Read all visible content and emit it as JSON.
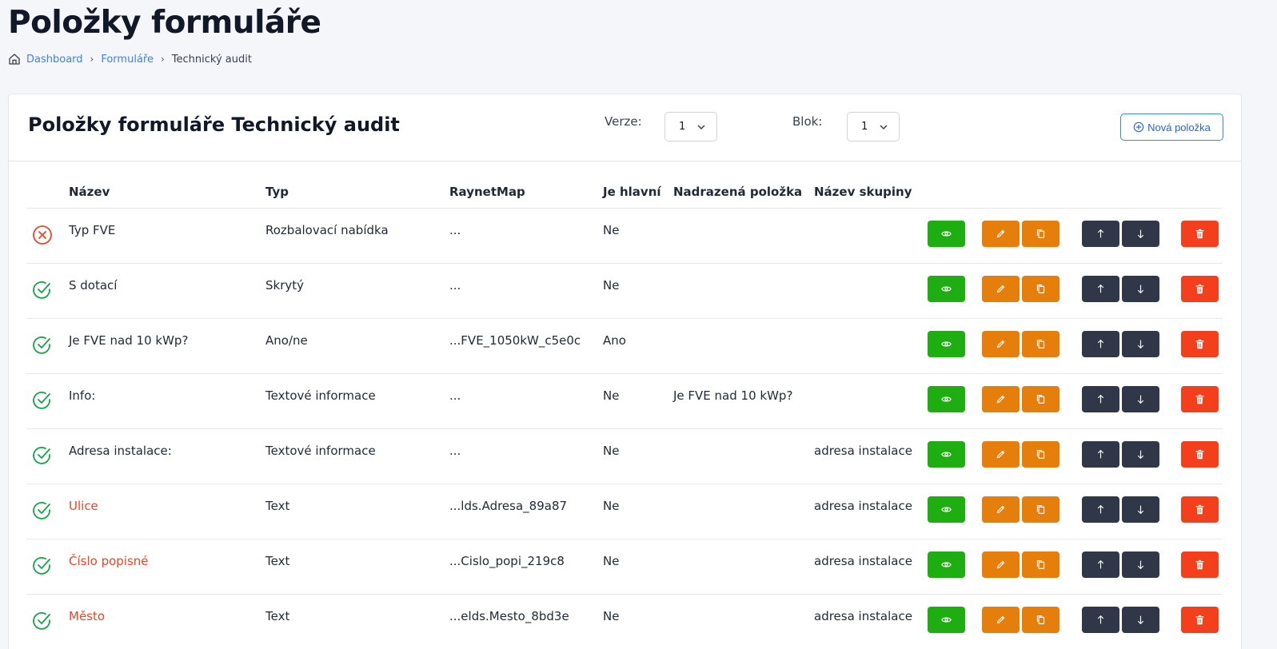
{
  "page": {
    "title": "Položky formuláře",
    "breadcrumb": [
      "Dashboard",
      "Formuláře",
      "Technický audit"
    ]
  },
  "card": {
    "title": "Položky formuláře Technický audit",
    "version_label": "Verze:",
    "version_value": "1",
    "block_label": "Blok:",
    "block_value": "1",
    "new_item_label": "Nová položka"
  },
  "table": {
    "columns": [
      "Název",
      "Typ",
      "RaynetMap",
      "Je hlavní",
      "Nadrazená položka",
      "Název skupiny"
    ],
    "rows": [
      {
        "status": "invalid",
        "name": "Typ FVE",
        "required": false,
        "type": "Rozbalovací nabídka",
        "raynet": "...",
        "main": "Ne",
        "parent": "",
        "group": ""
      },
      {
        "status": "valid",
        "name": "S dotací",
        "required": false,
        "type": "Skrytý",
        "raynet": "...",
        "main": "Ne",
        "parent": "",
        "group": ""
      },
      {
        "status": "valid",
        "name": "Je FVE nad 10 kWp?",
        "required": false,
        "type": "Ano/ne",
        "raynet": "...FVE_1050kW_c5e0c",
        "main": "Ano",
        "parent": "",
        "group": ""
      },
      {
        "status": "valid",
        "name": "Info:",
        "required": false,
        "type": "Textové informace",
        "raynet": "...",
        "main": "Ne",
        "parent": "Je FVE nad 10 kWp?",
        "group": ""
      },
      {
        "status": "valid",
        "name": "Adresa instalace:",
        "required": false,
        "type": "Textové informace",
        "raynet": "...",
        "main": "Ne",
        "parent": "",
        "group": "adresa instalace"
      },
      {
        "status": "valid",
        "name": "Ulice",
        "required": true,
        "type": "Text",
        "raynet": "...lds.Adresa_89a87",
        "main": "Ne",
        "parent": "",
        "group": "adresa instalace"
      },
      {
        "status": "valid",
        "name": "Číslo popisné",
        "required": true,
        "type": "Text",
        "raynet": "...Cislo_popi_219c8",
        "main": "Ne",
        "parent": "",
        "group": "adresa instalace"
      },
      {
        "status": "valid",
        "name": "Město",
        "required": true,
        "type": "Text",
        "raynet": "...elds.Mesto_8bd3e",
        "main": "Ne",
        "parent": "",
        "group": "adresa instalace"
      }
    ]
  },
  "colors": {
    "view": "#1eae11",
    "edit": "#e67e0b",
    "move": "#2f3748",
    "delete": "#f43f1c",
    "link": "#3b82f6",
    "required_name": "#ef4425",
    "valid_icon": "#16a34a",
    "invalid_icon": "#ef4425"
  },
  "icons": {
    "row_actions": [
      "eye-icon",
      "pencil-icon",
      "copy-icon",
      "arrow-up-icon",
      "arrow-down-icon",
      "trash-icon"
    ]
  }
}
